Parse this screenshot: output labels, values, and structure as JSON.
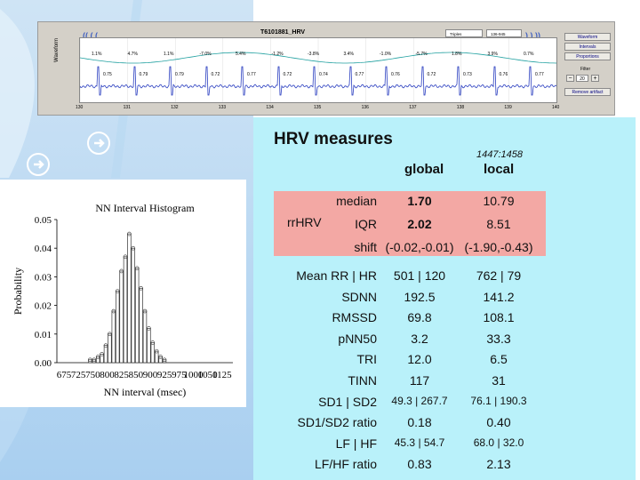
{
  "colors": {
    "hrv_bg": "#b9f1fa",
    "pink_block": "#f3a8a4",
    "slide_bg": "#a9cff0",
    "wave_blue": "#2b3fc0",
    "wave_green": "#20a0a0"
  },
  "waveform_app": {
    "title": "T6101881_HRV",
    "nav_left": "(( ( (",
    "nav_right": ") ) ))",
    "mode_box": "Triples",
    "range_box": "136-945",
    "ylabel": "Waveform",
    "x_ticks": [
      "130",
      "131",
      "132",
      "133",
      "134",
      "135",
      "136",
      "137",
      "138",
      "139",
      "140"
    ],
    "percents": [
      "1.1%",
      "4.7%",
      "1.1%",
      "-7.0%",
      "5.4%",
      "-1.2%",
      "-3.8%",
      "3.4%",
      "-1.0%",
      "-5.7%",
      "1.8%",
      "3.9%",
      "0.7%"
    ],
    "rr_values": [
      "0.75",
      "0.79",
      "0.79",
      "0.72",
      "0.77",
      "0.72",
      "0.74",
      "0.77",
      "0.76",
      "0.72",
      "0.73",
      "0.76",
      "0.77"
    ],
    "buttons": [
      "Waveform",
      "Intervals",
      "Proportions"
    ],
    "filter_label": "Filter",
    "filter_minus": "−",
    "filter_value": "20",
    "filter_plus": "+",
    "remove_artifact": "Remove artifact",
    "icons": [
      "left-arrow-icon",
      "right-arrow-icon"
    ]
  },
  "histogram": {
    "title": "NN Interval Histogram",
    "xlabel": "NN interval (msec)",
    "ylabel": "Probability",
    "x_ticks": [
      "675",
      "725",
      "750",
      "800",
      "825",
      "850",
      "900",
      "925",
      "975",
      "1000",
      "1050",
      "1125"
    ],
    "y_ticks": [
      "0.00",
      "0.01",
      "0.02",
      "0.03",
      "0.04",
      "0.05"
    ]
  },
  "chart_data": {
    "type": "bar",
    "title": "NN Interval Histogram",
    "xlabel": "NN interval (msec)",
    "ylabel": "Probability",
    "xlim": [
      675,
      1125
    ],
    "ylim": [
      0,
      0.05
    ],
    "categories": [
      "760",
      "770",
      "780",
      "790",
      "800",
      "810",
      "820",
      "830",
      "840",
      "850",
      "860",
      "870",
      "880",
      "890",
      "900",
      "910",
      "920",
      "930",
      "940",
      "950"
    ],
    "values": [
      0.001,
      0.001,
      0.002,
      0.003,
      0.006,
      0.01,
      0.018,
      0.025,
      0.032,
      0.037,
      0.045,
      0.04,
      0.033,
      0.026,
      0.018,
      0.012,
      0.007,
      0.004,
      0.002,
      0.001
    ]
  },
  "hrv": {
    "title": "HRV measures",
    "local_range": "1447:1458",
    "col_global": "global",
    "col_local": "local",
    "rrhrv_label": "rrHRV",
    "rrhrv_rows": [
      {
        "name": "median",
        "global": "1.70",
        "local": "10.79"
      },
      {
        "name": "IQR",
        "global": "2.02",
        "local": "8.51"
      },
      {
        "name": "shift",
        "global": "(-0.02,-0.01)",
        "local": "(-1.90,-0.43)"
      }
    ],
    "rows": [
      {
        "name": "Mean RR | HR",
        "global": "501 | 120",
        "local": "762 | 79"
      },
      {
        "name": "SDNN",
        "global": "192.5",
        "local": "141.2"
      },
      {
        "name": "RMSSD",
        "global": "69.8",
        "local": "108.1"
      },
      {
        "name": "pNN50",
        "global": "3.2",
        "local": "33.3"
      },
      {
        "name": "TRI",
        "global": "12.0",
        "local": "6.5"
      },
      {
        "name": "TINN",
        "global": "117",
        "local": "31"
      },
      {
        "name": "SD1 | SD2",
        "global": "49.3 | 267.7",
        "local": "76.1 | 190.3"
      },
      {
        "name": "SD1/SD2 ratio",
        "global": "0.18",
        "local": "0.40"
      },
      {
        "name": "LF | HF",
        "global": "45.3 | 54.7",
        "local": "68.0 | 32.0"
      },
      {
        "name": "LF/HF ratio",
        "global": "0.83",
        "local": "2.13"
      }
    ]
  }
}
